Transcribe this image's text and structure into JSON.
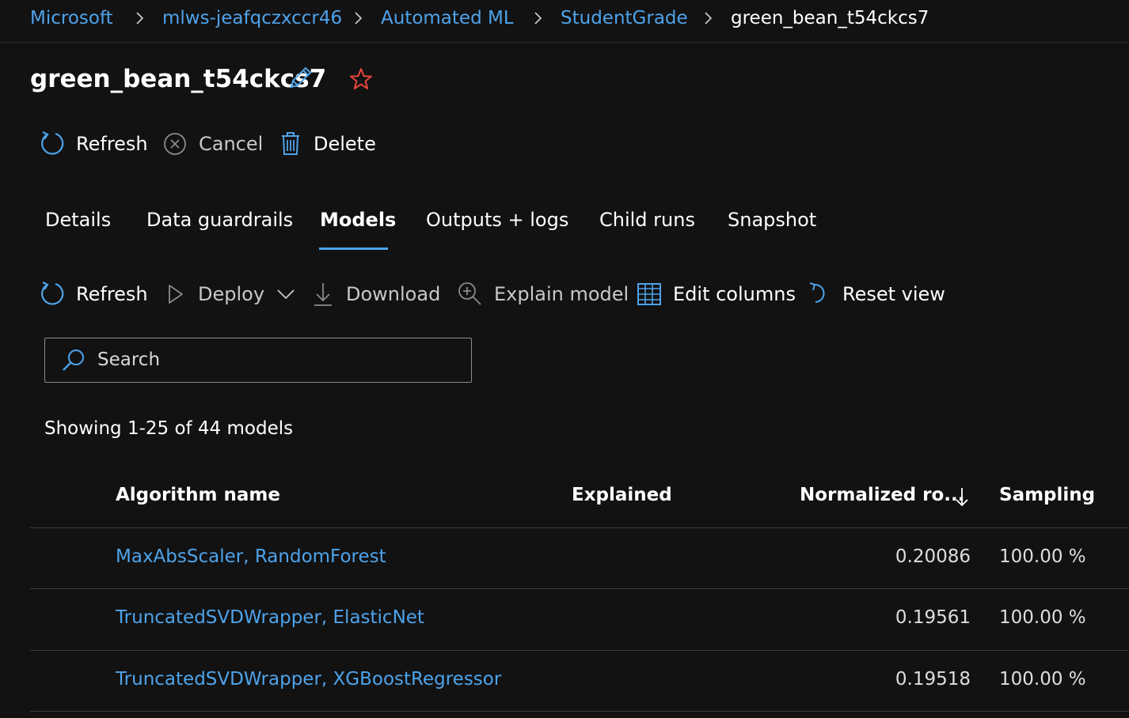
{
  "breadcrumb": [
    {
      "label": "Microsoft"
    },
    {
      "label": "mlws-jeafqczxccr46"
    },
    {
      "label": "Automated ML"
    },
    {
      "label": "StudentGrade"
    },
    {
      "label": "green_bean_t54ckcs7"
    }
  ],
  "header": {
    "title": "green_bean_t54ckcs7",
    "icons": [
      "edit-icon",
      "favorite-star-icon"
    ]
  },
  "run_toolbar": {
    "refresh": "Refresh",
    "cancel": "Cancel",
    "delete": "Delete"
  },
  "tabs": [
    {
      "label": "Details"
    },
    {
      "label": "Data guardrails"
    },
    {
      "label": "Models",
      "active": true
    },
    {
      "label": "Outputs + logs"
    },
    {
      "label": "Child runs"
    },
    {
      "label": "Snapshot"
    }
  ],
  "models_toolbar": {
    "refresh": "Refresh",
    "deploy": "Deploy",
    "download": "Download",
    "explain": "Explain model",
    "edit_columns": "Edit columns",
    "reset_view": "Reset view"
  },
  "search": {
    "placeholder": "Search"
  },
  "summary": "Showing 1-25 of 44 models",
  "table": {
    "columns": [
      "Algorithm name",
      "Explained",
      "Normalized ro...",
      "Sampling"
    ],
    "sort_column": "Normalized ro...",
    "sort_direction": "descending",
    "rows": [
      {
        "algorithm": "MaxAbsScaler, RandomForest",
        "explained": "",
        "metric": "0.20086",
        "sampling": "100.00 %"
      },
      {
        "algorithm": "TruncatedSVDWrapper, ElasticNet",
        "explained": "",
        "metric": "0.19561",
        "sampling": "100.00 %"
      },
      {
        "algorithm": "TruncatedSVDWrapper, XGBoostRegressor",
        "explained": "",
        "metric": "0.19518",
        "sampling": "100.00 %"
      }
    ]
  },
  "colors": {
    "accent": "#4ea3ea",
    "background": "#121212",
    "favorite": "#e8453c"
  }
}
